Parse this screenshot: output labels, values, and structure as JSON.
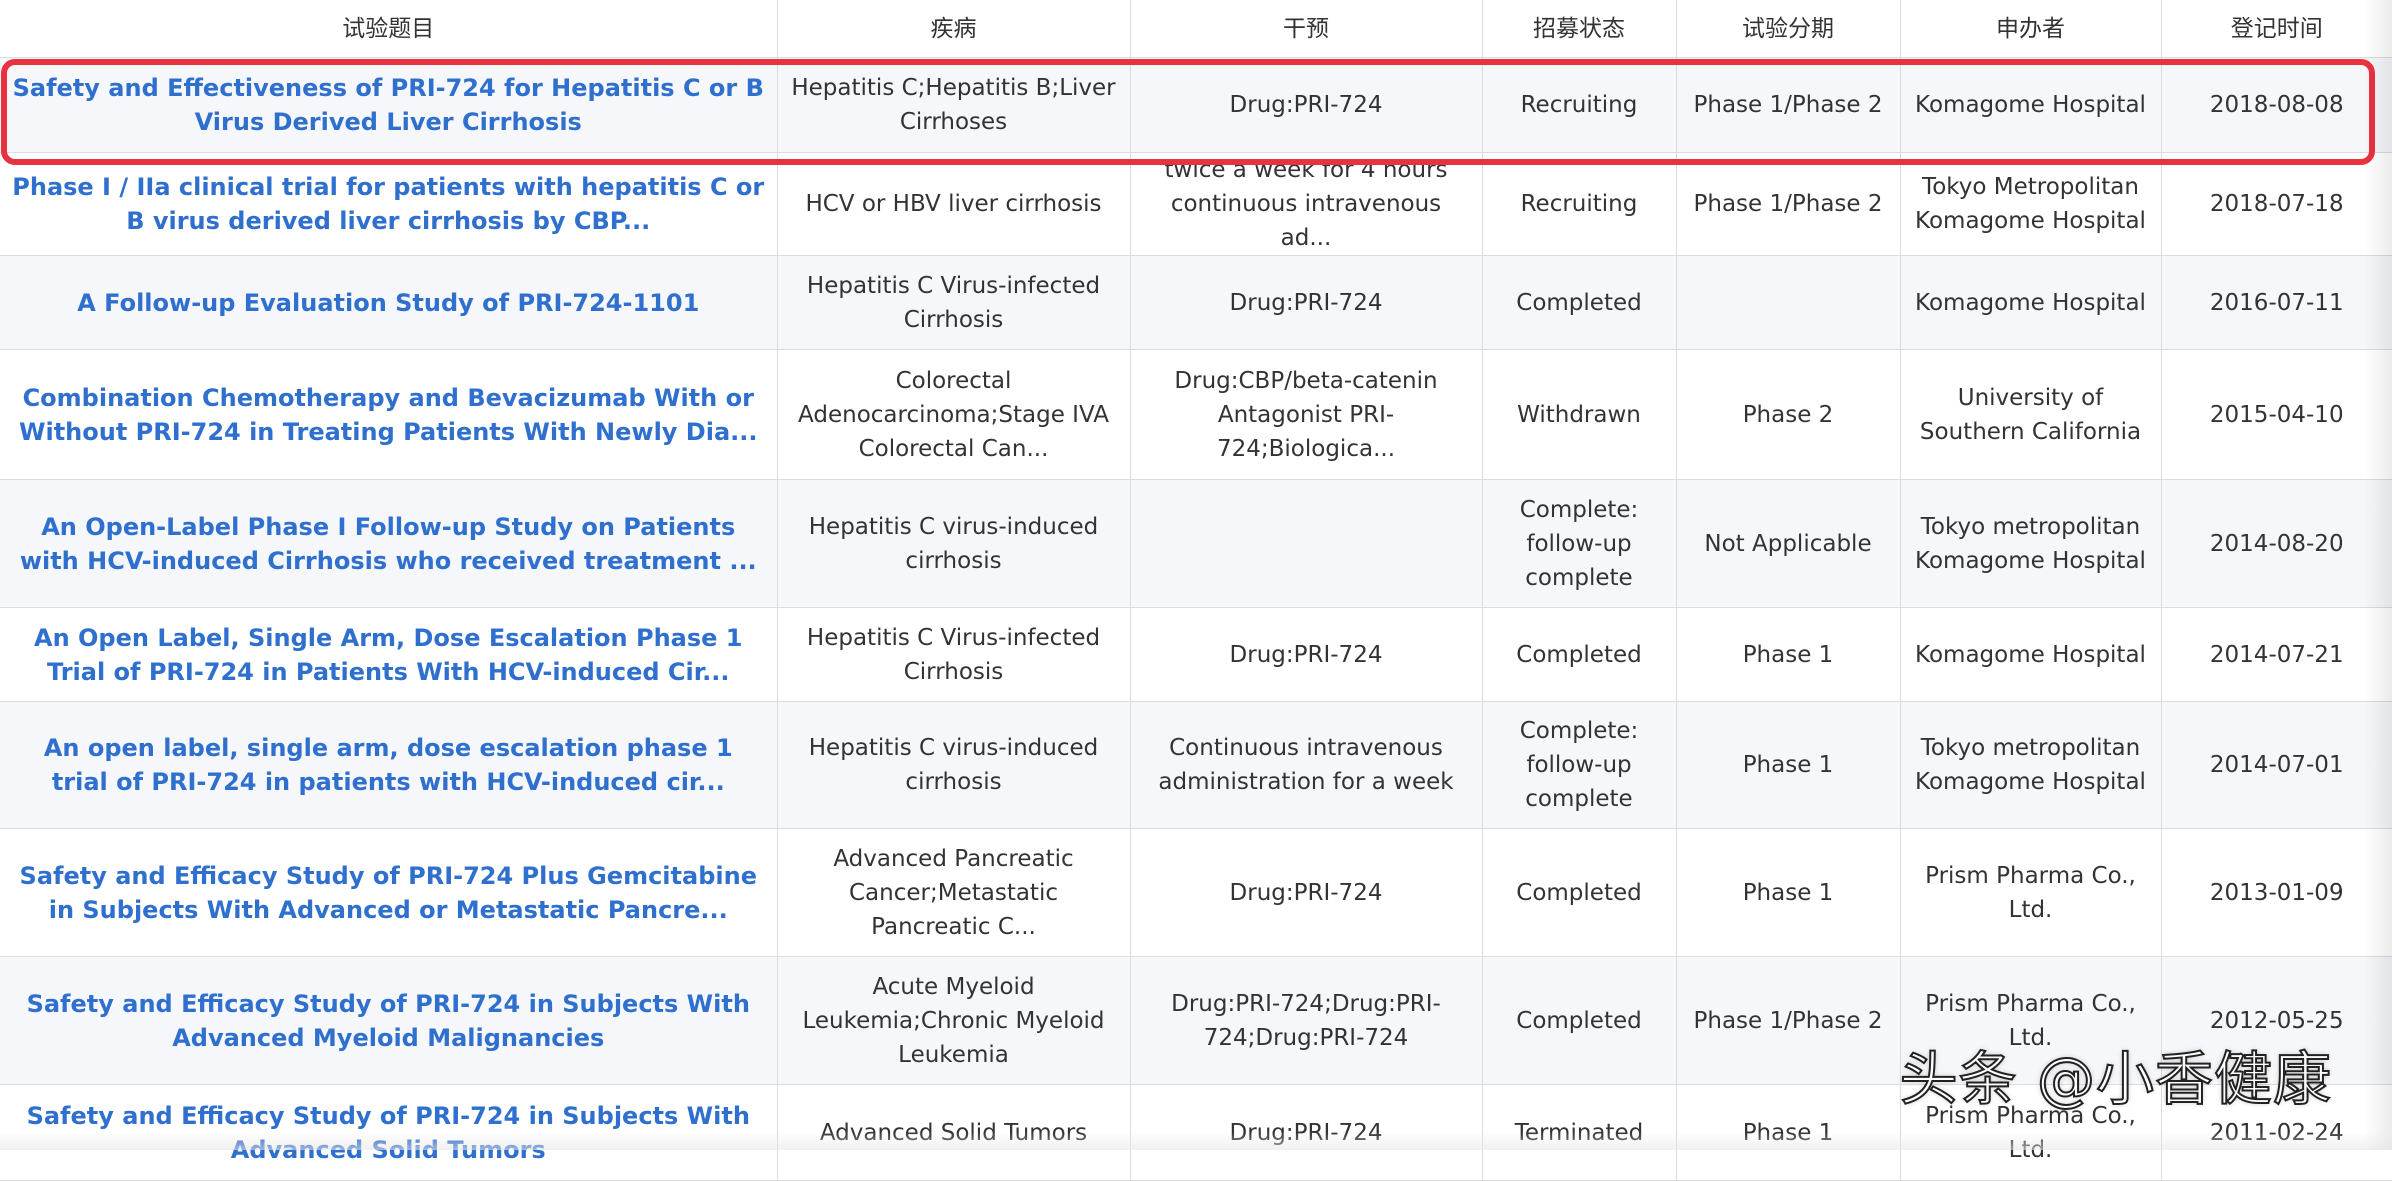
{
  "columns": {
    "title": "试验题目",
    "disease": "疾病",
    "intervention": "干预",
    "status": "招募状态",
    "phase": "试验分期",
    "sponsor": "申办者",
    "date": "登记时间"
  },
  "rows": [
    {
      "title": "Safety and Effectiveness of PRI-724 for Hepatitis C or B Virus Derived Liver Cirrhosis",
      "disease": "Hepatitis C;Hepatitis B;Liver Cirrhoses",
      "intervention": "Drug:PRI-724",
      "status": "Recruiting",
      "phase": "Phase 1/Phase 2",
      "sponsor": "Komagome Hospital",
      "date": "2018-08-08"
    },
    {
      "title": "Phase I / IIa clinical trial for patients with hepatitis C or B virus derived liver cirrhosis by CBP...",
      "disease": "HCV or HBV liver cirrhosis",
      "intervention": "twice a week for 4 hours continuous intravenous ad...",
      "status": "Recruiting",
      "phase": "Phase 1/Phase 2",
      "sponsor": "Tokyo Metropolitan Komagome Hospital",
      "date": "2018-07-18"
    },
    {
      "title": "A Follow-up Evaluation Study of PRI-724-1101",
      "disease": "Hepatitis C Virus-infected Cirrhosis",
      "intervention": "Drug:PRI-724",
      "status": "Completed",
      "phase": "",
      "sponsor": "Komagome Hospital",
      "date": "2016-07-11"
    },
    {
      "title": "Combination Chemotherapy and Bevacizumab With or Without PRI-724 in Treating Patients With Newly Dia...",
      "disease": "Colorectal Adenocarcinoma;Stage IVA Colorectal Can...",
      "intervention": "Drug:CBP/beta-catenin Antagonist PRI-724;Biologica...",
      "status": "Withdrawn",
      "phase": "Phase 2",
      "sponsor": "University of Southern California",
      "date": "2015-04-10"
    },
    {
      "title": "An Open-Label Phase I Follow-up Study on Patients with HCV-induced Cirrhosis who received treatment ...",
      "disease": "Hepatitis C virus-induced cirrhosis",
      "intervention": "",
      "status": "Complete: follow-up complete",
      "phase": "Not Applicable",
      "sponsor": "Tokyo metropolitan Komagome Hospital",
      "date": "2014-08-20"
    },
    {
      "title": "An Open Label, Single Arm, Dose Escalation Phase 1 Trial of PRI-724 in Patients With HCV-induced Cir...",
      "disease": "Hepatitis C Virus-infected Cirrhosis",
      "intervention": "Drug:PRI-724",
      "status": "Completed",
      "phase": "Phase 1",
      "sponsor": "Komagome Hospital",
      "date": "2014-07-21"
    },
    {
      "title": "An open label, single arm, dose escalation phase 1 trial of PRI-724 in patients with HCV-induced cir...",
      "disease": "Hepatitis C virus-induced cirrhosis",
      "intervention": "Continuous intravenous administration for a week",
      "status": "Complete: follow-up complete",
      "phase": "Phase 1",
      "sponsor": "Tokyo metropolitan Komagome Hospital",
      "date": "2014-07-01"
    },
    {
      "title": "Safety and Efficacy Study of PRI-724 Plus Gemcitabine in Subjects With Advanced or Metastatic Pancre...",
      "disease": "Advanced Pancreatic Cancer;Metastatic Pancreatic C...",
      "intervention": "Drug:PRI-724",
      "status": "Completed",
      "phase": "Phase 1",
      "sponsor": "Prism Pharma Co., Ltd.",
      "date": "2013-01-09"
    },
    {
      "title": "Safety and Efficacy Study of PRI-724 in Subjects With Advanced Myeloid Malignancies",
      "disease": "Acute Myeloid Leukemia;Chronic Myeloid Leukemia",
      "intervention": "Drug:PRI-724;Drug:PRI-724;Drug:PRI-724",
      "status": "Completed",
      "phase": "Phase 1/Phase 2",
      "sponsor": "Prism Pharma Co., Ltd.",
      "date": "2012-05-25"
    },
    {
      "title": "Safety and Efficacy Study of PRI-724 in Subjects With Advanced Solid Tumors",
      "disease": "Advanced Solid Tumors",
      "intervention": "Drug:PRI-724",
      "status": "Terminated",
      "phase": "Phase 1",
      "sponsor": "Prism Pharma Co., Ltd.",
      "date": "2011-02-24"
    }
  ],
  "highlight": {
    "color": "#e8323f"
  },
  "colors": {
    "title_link": "#2f6fce",
    "row_alt": "#f5f7fa",
    "border": "#dcdcdc"
  },
  "watermark": "头条 @小香健康"
}
